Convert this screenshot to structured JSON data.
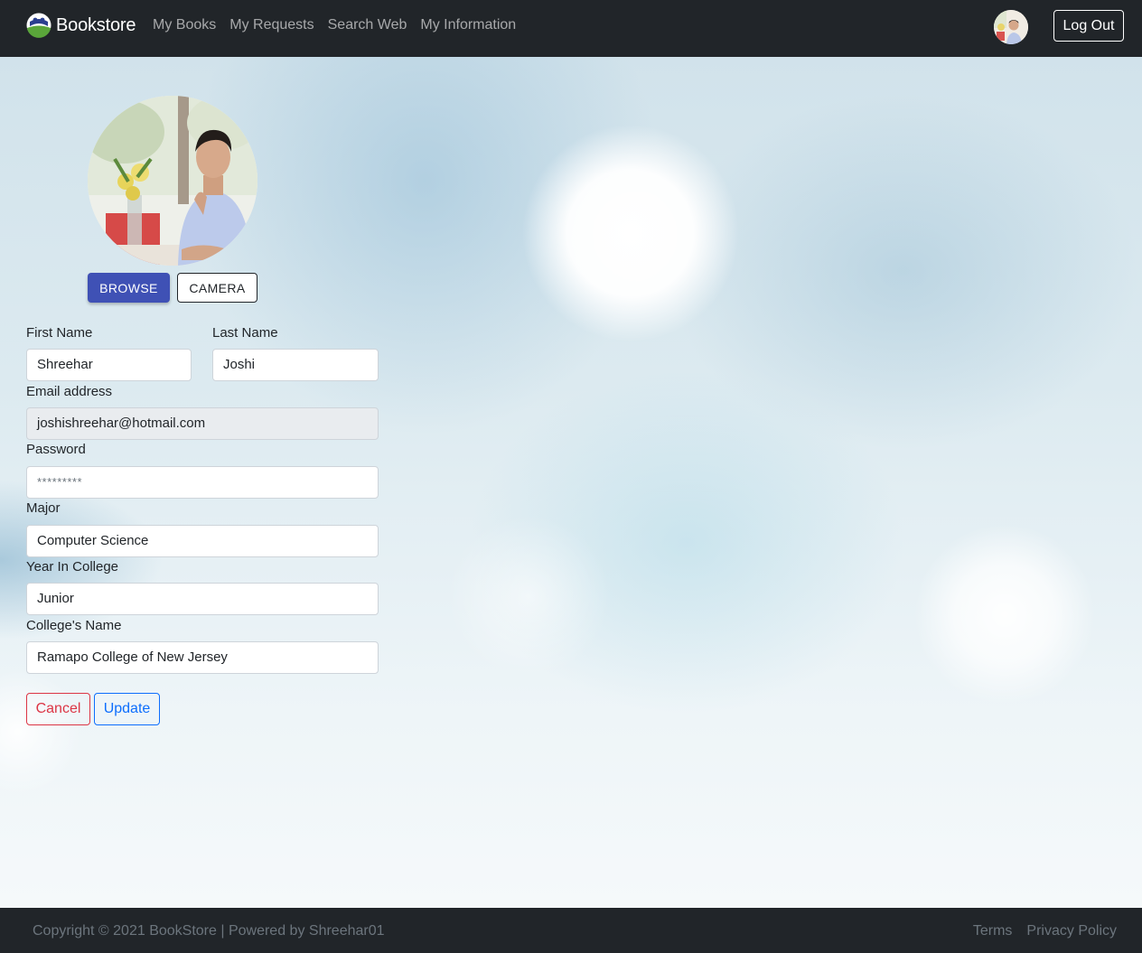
{
  "navbar": {
    "brand": "Bookstore",
    "brand_icon": "bookstore-logo-icon",
    "links": [
      "My Books",
      "My Requests",
      "Search Web",
      "My Information"
    ],
    "logout_label": "Log Out"
  },
  "profile": {
    "browse_label": "BROWSE",
    "camera_label": "CAMERA"
  },
  "form": {
    "first_name": {
      "label": "First Name",
      "value": "Shreehar"
    },
    "last_name": {
      "label": "Last Name",
      "value": "Joshi"
    },
    "email": {
      "label": "Email address",
      "value": "joshishreehar@hotmail.com"
    },
    "password": {
      "label": "Password",
      "placeholder": "*********"
    },
    "major": {
      "label": "Major",
      "value": "Computer Science"
    },
    "year": {
      "label": "Year In College",
      "value": "Junior"
    },
    "college": {
      "label": "College's Name",
      "value": "Ramapo College of New Jersey"
    },
    "cancel_label": "Cancel",
    "update_label": "Update"
  },
  "footer": {
    "copyright": "Copyright © 2021 BookStore | Powered by Shreehar01",
    "links": [
      "Terms",
      "Privacy Policy"
    ]
  },
  "colors": {
    "navbar": "#212529",
    "primary_button": "#3f51b5",
    "cancel": "#dc3545",
    "update": "#0d6efd"
  }
}
